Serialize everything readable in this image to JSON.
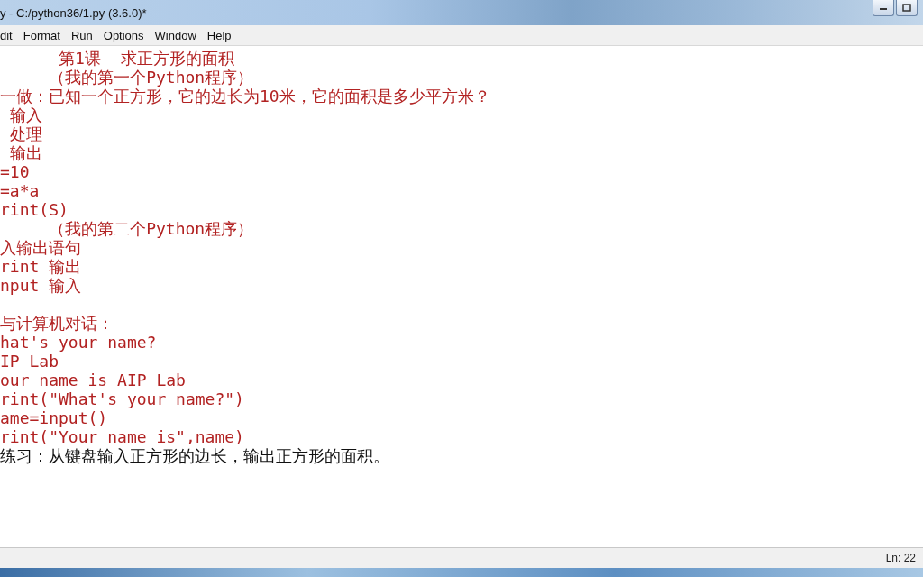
{
  "window": {
    "title": "y - C:/python36/1.py (3.6.0)*"
  },
  "menu": [
    "dit",
    "Format",
    "Run",
    "Options",
    "Window",
    "Help"
  ],
  "editor": {
    "lines": [
      {
        "kind": "colored",
        "text": "      第1课  求正方形的面积"
      },
      {
        "kind": "colored",
        "text": "     （我的第一个Python程序）"
      },
      {
        "kind": "colored",
        "text": "一做：已知一个正方形，它的边长为10米，它的面积是多少平方米？"
      },
      {
        "kind": "colored",
        "text": " 输入"
      },
      {
        "kind": "colored",
        "text": " 处理"
      },
      {
        "kind": "colored",
        "text": " 输出"
      },
      {
        "kind": "colored",
        "text": "=10"
      },
      {
        "kind": "colored",
        "text": "=a*a"
      },
      {
        "kind": "colored",
        "text": "rint(S)"
      },
      {
        "kind": "colored",
        "text": "     （我的第二个Python程序）"
      },
      {
        "kind": "colored",
        "text": "入输出语句"
      },
      {
        "kind": "colored",
        "text": "rint 输出"
      },
      {
        "kind": "colored",
        "text": "nput 输入"
      },
      {
        "kind": "blank"
      },
      {
        "kind": "colored",
        "text": "与计算机对话："
      },
      {
        "kind": "colored",
        "text": "hat's your name?"
      },
      {
        "kind": "colored",
        "text": "IP Lab"
      },
      {
        "kind": "colored",
        "text": "our name is AIP Lab"
      },
      {
        "kind": "colored",
        "text": "rint(\"What's your name?\")"
      },
      {
        "kind": "colored",
        "text": "ame=input()"
      },
      {
        "kind": "colored",
        "text": "rint(\"Your name is\",name)"
      },
      {
        "kind": "plain",
        "text": "练习：从键盘输入正方形的边长，输出正方形的面积。"
      }
    ]
  },
  "status_bar": {
    "position": "Ln: 22"
  }
}
